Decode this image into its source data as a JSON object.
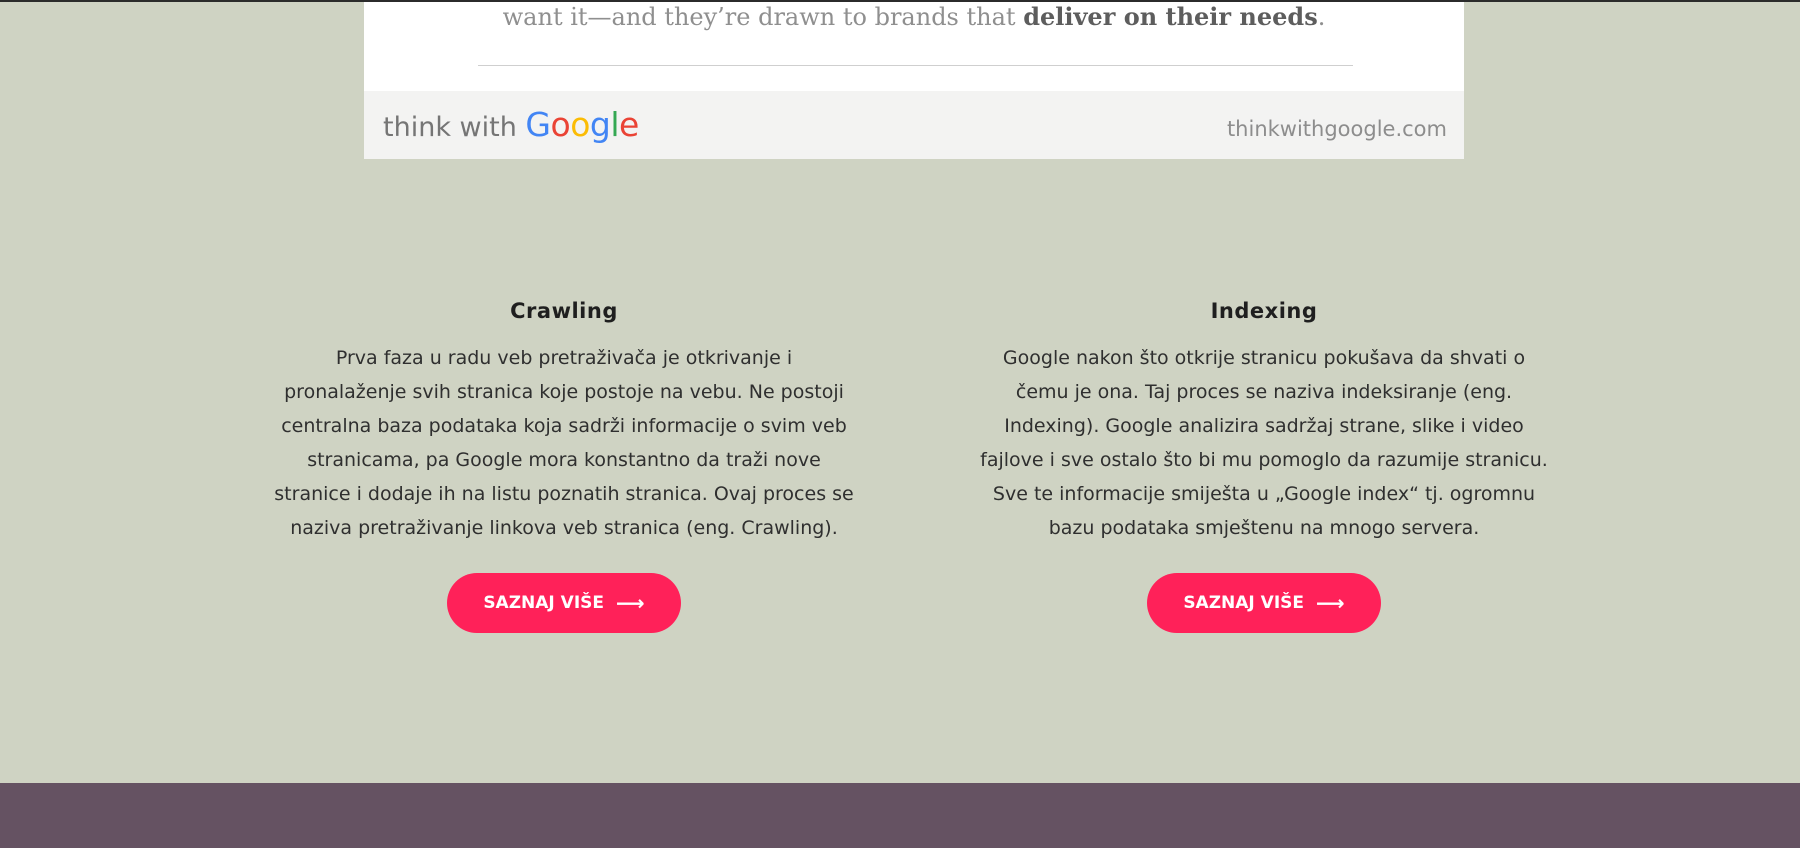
{
  "infographic": {
    "quote_text": "want it—and they’re drawn to brands that ",
    "quote_emphasis": "deliver on their needs",
    "quote_end": ".",
    "logo_prefix": "think with ",
    "logo_letters": [
      "G",
      "o",
      "o",
      "g",
      "l",
      "e"
    ],
    "url": "thinkwithgoogle.com"
  },
  "features": [
    {
      "title": "Crawling",
      "text": "Prva faza u radu veb pretraživača je otkrivanje i pronalaženje svih stranica koje postoje na vebu. Ne postoji centralna baza podataka koja sadrži informacije o svim veb stranicama, pa Google mora konstantno da traži nove stranice i dodaje ih na listu poznatih stranica. Ovaj proces se naziva pretraživanje linkova veb stranica (eng. Crawling).",
      "button_label": "SAZNAJ VIŠE",
      "button_icon": "arrow-right-icon"
    },
    {
      "title": "Indexing",
      "text": "Google nakon što otkrije stranicu pokušava da shvati o čemu je ona. Taj proces se naziva indeksiranje (eng. Indexing). Google analizira sadržaj strane, slike i video fajlove i sve ostalo što bi mu pomoglo da razumije stranicu. Sve te informacije smiješta u „Google index“ tj. ogromnu bazu podataka smještenu na mnogo servera.",
      "button_label": "SAZNAJ VIŠE",
      "button_icon": "arrow-right-icon"
    }
  ],
  "colors": {
    "page_background": "#cfd3c3",
    "button_background": "#ff2159",
    "footer_band": "#655262"
  }
}
